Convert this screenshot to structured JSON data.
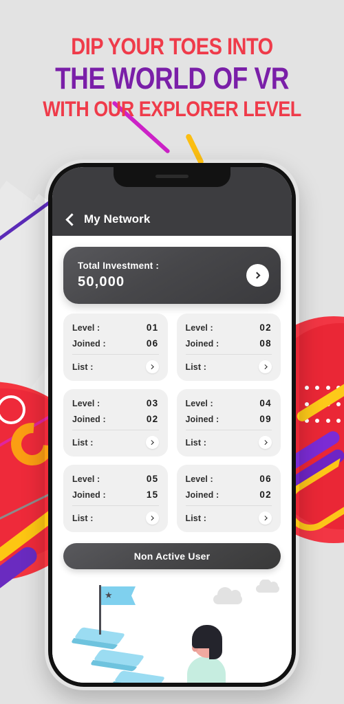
{
  "poster": {
    "headline_line1": "DIP YOUR TOES INTO",
    "headline_line2": "THE WORLD OF VR",
    "headline_line3": "WITH OUR EXPLORER LEVEL",
    "colors": {
      "background": "#e3e3e3",
      "headline_red": "#ef3b4a",
      "headline_purple": "#7a1fa8",
      "accent_red": "#f23644",
      "accent_orange": "#fb9e13",
      "accent_yellow": "#fdc619",
      "accent_magenta": "#cc22c7",
      "accent_purple": "#6a2bc0"
    }
  },
  "app": {
    "header": {
      "back_icon": "chevron-left-icon",
      "title": "My Network"
    },
    "investment_card": {
      "label": "Total Investment :",
      "value": "50,000",
      "arrow_icon": "chevron-right-icon"
    },
    "level_cards": [
      {
        "level_label": "Level :",
        "level_value": "01",
        "joined_label": "Joined :",
        "joined_value": "06",
        "list_label": "List :",
        "list_icon": "chevron-right-icon"
      },
      {
        "level_label": "Level :",
        "level_value": "02",
        "joined_label": "Joined :",
        "joined_value": "08",
        "list_label": "List :",
        "list_icon": "chevron-right-icon"
      },
      {
        "level_label": "Level :",
        "level_value": "03",
        "joined_label": "Joined :",
        "joined_value": "02",
        "list_label": "List :",
        "list_icon": "chevron-right-icon"
      },
      {
        "level_label": "Level :",
        "level_value": "04",
        "joined_label": "Joined :",
        "joined_value": "09",
        "list_label": "List :",
        "list_icon": "chevron-right-icon"
      },
      {
        "level_label": "Level :",
        "level_value": "05",
        "joined_label": "Joined :",
        "joined_value": "15",
        "list_label": "List :",
        "list_icon": "chevron-right-icon"
      },
      {
        "level_label": "Level :",
        "level_value": "06",
        "joined_label": "Joined :",
        "joined_value": "02",
        "list_label": "List :",
        "list_icon": "chevron-right-icon"
      }
    ],
    "non_active_button": "Non Active User",
    "illustration": {
      "flag_icon": "flag-with-star-icon",
      "steps_icon": "stacked-steps-icon",
      "person_icon": "person-avatar-icon",
      "cloud_icon": "cloud-icon"
    }
  }
}
